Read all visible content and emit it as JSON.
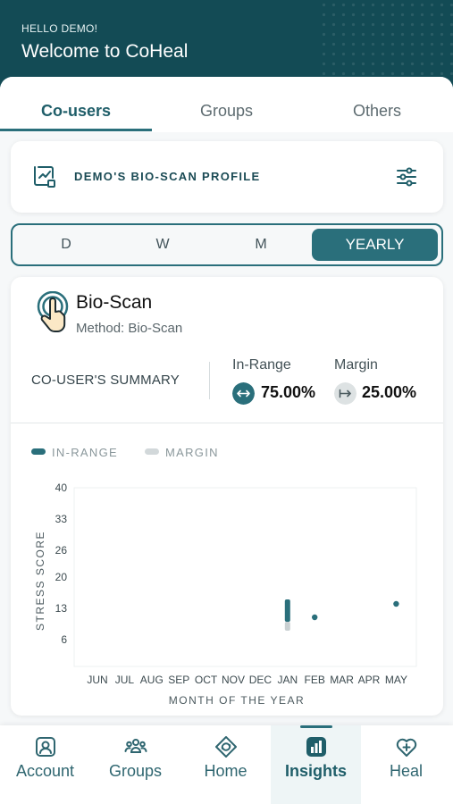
{
  "header": {
    "greeting": "HELLO DEMO!",
    "title": "Welcome to CoHeal"
  },
  "tabs": [
    {
      "label": "Co-users",
      "active": true
    },
    {
      "label": "Groups",
      "active": false
    },
    {
      "label": "Others",
      "active": false
    }
  ],
  "profile": {
    "title": "DEMO'S BIO-SCAN PROFILE",
    "icon": "chart-report-icon",
    "filter_icon": "sliders-icon"
  },
  "period": {
    "options": [
      "D",
      "W",
      "M",
      "YEARLY"
    ],
    "selected": "YEARLY"
  },
  "scan": {
    "title": "Bio-Scan",
    "method": "Method: Bio-Scan",
    "icon": "touch-fingerprint-icon"
  },
  "summary": {
    "label": "CO-USER'S SUMMARY",
    "in_range": {
      "label": "In-Range",
      "value": "75.00%",
      "icon": "arrows-horizontal-icon"
    },
    "margin": {
      "label": "Margin",
      "value": "25.00%",
      "icon": "arrow-right-bar-icon"
    }
  },
  "legend": {
    "in_range": "IN-RANGE",
    "margin": "MARGIN"
  },
  "colors": {
    "primary": "#2a6f7b",
    "header": "#134b55",
    "margin": "#c9d0d2"
  },
  "chart_data": {
    "type": "scatter",
    "xlabel": "MONTH OF THE YEAR",
    "ylabel": "STRESS SCORE",
    "categories": [
      "JUN",
      "JUL",
      "AUG",
      "SEP",
      "OCT",
      "NOV",
      "DEC",
      "JAN",
      "FEB",
      "MAR",
      "APR",
      "MAY"
    ],
    "y_ticks": [
      40,
      33,
      26,
      20,
      13,
      6
    ],
    "ylim": [
      0,
      40
    ],
    "grid": false,
    "legend": "top-left",
    "series": [
      {
        "name": "IN-RANGE",
        "points": [
          {
            "x": "JAN",
            "low": 10,
            "high": 15
          },
          {
            "x": "FEB",
            "low": 11,
            "high": 11
          },
          {
            "x": "MAY",
            "low": 14,
            "high": 14
          }
        ]
      },
      {
        "name": "MARGIN",
        "points": [
          {
            "x": "JAN",
            "low": 8,
            "high": 10
          }
        ]
      }
    ]
  },
  "nav": [
    {
      "label": "Account",
      "icon": "user-icon",
      "active": false
    },
    {
      "label": "Groups",
      "icon": "group-icon",
      "active": false
    },
    {
      "label": "Home",
      "icon": "home-icon",
      "active": false
    },
    {
      "label": "Insights",
      "icon": "bar-chart-icon",
      "active": true
    },
    {
      "label": "Heal",
      "icon": "heart-plus-icon",
      "active": false
    }
  ]
}
